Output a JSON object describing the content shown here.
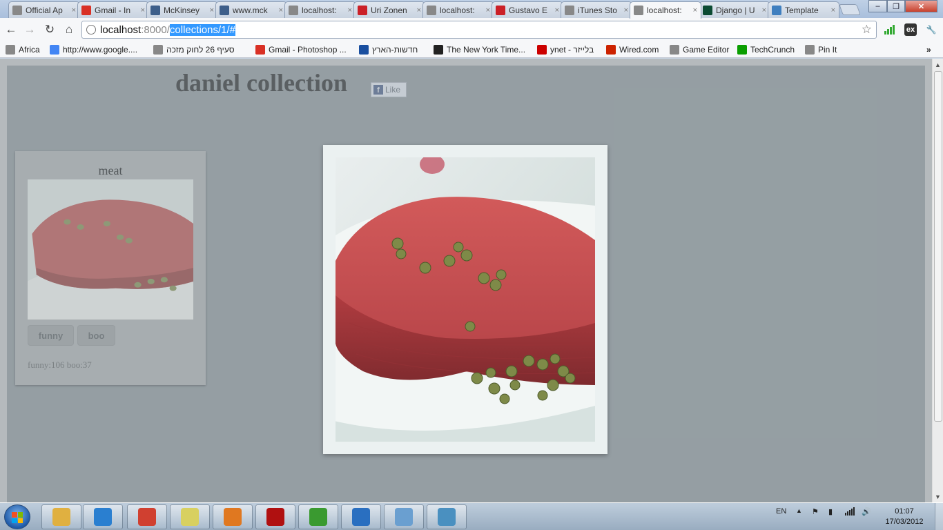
{
  "tabs": [
    {
      "title": "Official Ap",
      "icon": "page-icon",
      "color": "#888888"
    },
    {
      "title": "Gmail - In",
      "icon": "gmail-icon",
      "color": "#d93025"
    },
    {
      "title": "McKinsey",
      "icon": "mckinsey-icon",
      "color": "#3e5f8a"
    },
    {
      "title": "www.mck",
      "icon": "mckinsey-icon",
      "color": "#3e5f8a"
    },
    {
      "title": "localhost:",
      "icon": "globe-icon",
      "color": "#888888"
    },
    {
      "title": "Uri Zonen",
      "icon": "pinterest-icon",
      "color": "#cb2027"
    },
    {
      "title": "localhost:",
      "icon": "globe-icon",
      "color": "#888888"
    },
    {
      "title": "Gustavo E",
      "icon": "pinterest-icon",
      "color": "#cb2027"
    },
    {
      "title": "iTunes Sto",
      "icon": "page-icon",
      "color": "#888888"
    },
    {
      "title": "localhost:",
      "icon": "globe-icon",
      "color": "#888888"
    },
    {
      "title": "Django | U",
      "icon": "django-icon",
      "color": "#0c4b33"
    },
    {
      "title": "Template",
      "icon": "template-icon",
      "color": "#3f7fbf"
    }
  ],
  "active_tab_index": 9,
  "tab_close_glyph": "×",
  "window_controls": {
    "minimize": "–",
    "maximize": "❐",
    "close": "✕"
  },
  "nav": {
    "back": "←",
    "forward": "→",
    "reload": "↻",
    "home": "⌂",
    "star": "☆",
    "wrench": "🔧",
    "menu_more": "»"
  },
  "address": {
    "host": "localhost",
    "port": ":8000/",
    "selected_path": "collections/1/#"
  },
  "bookmarks": [
    {
      "label": "Africa",
      "icon": "globe-icon",
      "color": "#888888"
    },
    {
      "label": "http://www.google....",
      "icon": "google-icon",
      "color": "#4285f4"
    },
    {
      "label": "סעיף 26 לחוק מזכה",
      "icon": "globe-icon",
      "color": "#888888"
    },
    {
      "label": "Gmail - Photoshop ...",
      "icon": "gmail-icon",
      "color": "#d93025"
    },
    {
      "label": "חדשות-הארץ",
      "icon": "haaretz-icon",
      "color": "#1a4fa0"
    },
    {
      "label": "The New York Time...",
      "icon": "nyt-icon",
      "color": "#222222"
    },
    {
      "label": "ynet - בלייזר",
      "icon": "ynet-icon",
      "color": "#cc0000"
    },
    {
      "label": "Wired.com",
      "icon": "wired-icon",
      "color": "#cc2200"
    },
    {
      "label": "Game Editor",
      "icon": "globe-icon",
      "color": "#888888"
    },
    {
      "label": "TechCrunch",
      "icon": "techcrunch-icon",
      "color": "#0a9e01"
    },
    {
      "label": "Pin It",
      "icon": "globe-icon",
      "color": "#888888"
    }
  ],
  "page": {
    "title": "daniel collection",
    "like_label": "Like",
    "card": {
      "title": "meat",
      "buttons": [
        "funny",
        "boo"
      ],
      "stats": "funny:106 boo:37"
    }
  },
  "taskbar": {
    "apps": [
      {
        "name": "explorer",
        "icon": "folder-icon",
        "color": "#e0b040"
      },
      {
        "name": "media-player",
        "icon": "media-player-icon",
        "color": "#2a7fd0"
      },
      {
        "name": "chrome",
        "icon": "chrome-icon",
        "color": "#d04030"
      },
      {
        "name": "sticky-notes",
        "icon": "sticky-notes-icon",
        "color": "#d8d060"
      },
      {
        "name": "settings",
        "icon": "gear-icon",
        "color": "#e07820"
      },
      {
        "name": "acrobat",
        "icon": "acrobat-icon",
        "color": "#b01010"
      },
      {
        "name": "utorrent",
        "icon": "utorrent-icon",
        "color": "#3a9a30"
      },
      {
        "name": "itunes",
        "icon": "itunes-icon",
        "color": "#2a6fc0"
      },
      {
        "name": "paint",
        "icon": "paint-icon",
        "color": "#6a9fd0"
      },
      {
        "name": "photo-viewer",
        "icon": "photo-icon",
        "color": "#4a90c0"
      }
    ],
    "language": "EN",
    "time": "01:07",
    "date": "17/03/2012"
  }
}
